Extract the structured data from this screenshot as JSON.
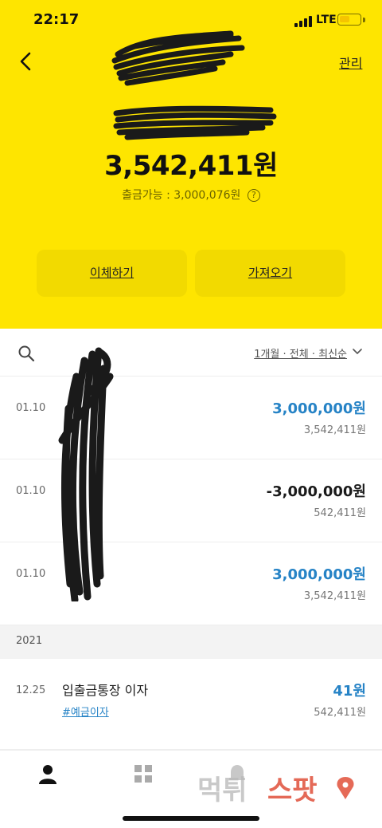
{
  "status_bar": {
    "time": "22:17",
    "network": "LTE"
  },
  "header": {
    "manage_label": "관리",
    "balance": "3,542,411원",
    "withdrawable_label": "출금가능 : 3,000,076원",
    "help_glyph": "?"
  },
  "actions": {
    "transfer_label": "이체하기",
    "fetch_label": "가져오기"
  },
  "filter": {
    "label": "1개월 · 전체 · 최신순"
  },
  "transactions": [
    {
      "date": "01.10",
      "amount": "3,000,000원",
      "balance": "3,542,411원",
      "color": "#2683c6"
    },
    {
      "date": "01.10",
      "amount": "-3,000,000원",
      "balance": "542,411원",
      "color": "#1a1a1a"
    },
    {
      "date": "01.10",
      "amount": "3,000,000원",
      "balance": "3,542,411원",
      "color": "#2683c6"
    }
  ],
  "year_section": {
    "label": "2021"
  },
  "interest_tx": {
    "date": "12.25",
    "description": "입출금통장 이자",
    "tag": "#예금이자",
    "amount": "41원",
    "balance": "542,411원"
  },
  "watermark": {
    "text": "먹튀스팟"
  },
  "colors": {
    "accent_yellow": "#FEE500",
    "deposit_blue": "#2683c6"
  },
  "icons": [
    "back-arrow-icon",
    "question-icon",
    "search-icon",
    "chevron-down-icon",
    "person-icon",
    "grid-icon",
    "bell-icon"
  ]
}
